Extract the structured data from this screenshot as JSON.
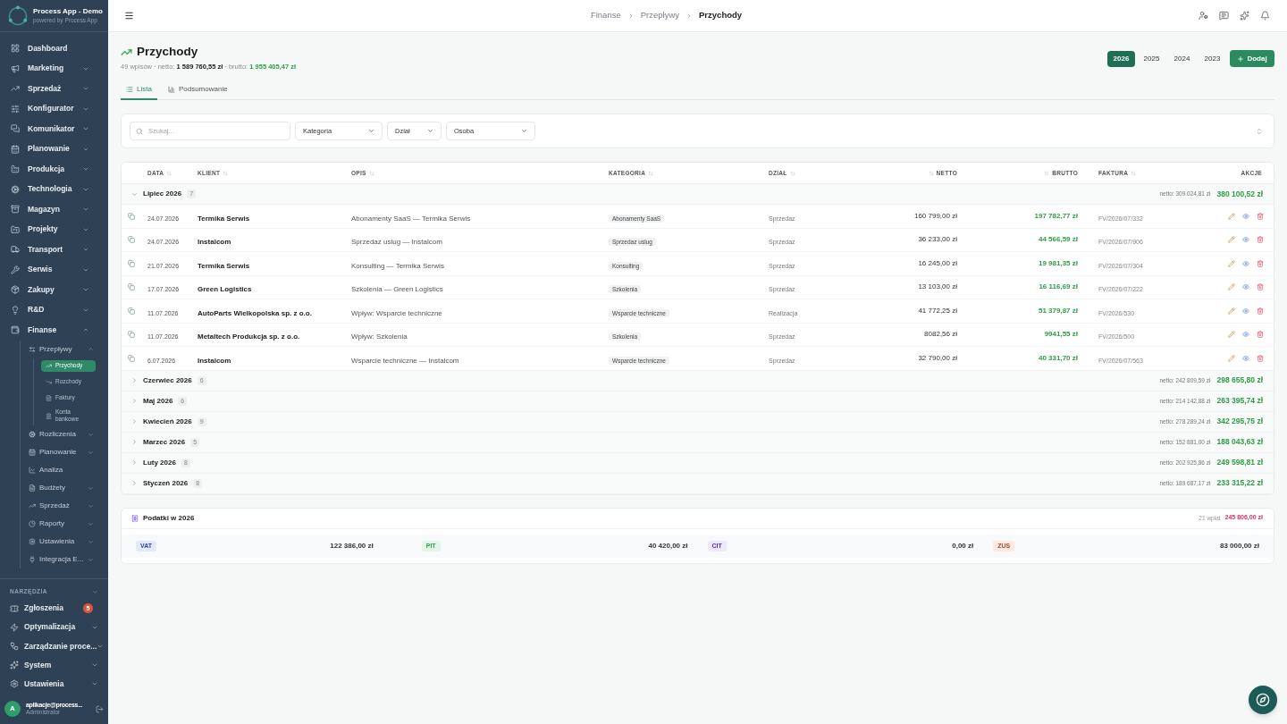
{
  "sidebar": {
    "brand": {
      "title": "Process App - Demo",
      "subtitle": "powered by Process App"
    },
    "items": [
      {
        "label": "Dashboard",
        "kind": "link",
        "selected": false
      },
      {
        "label": "Marketing",
        "kind": "group",
        "expanded": false
      },
      {
        "label": "Sprzedaż",
        "kind": "group",
        "expanded": false
      },
      {
        "label": "Konfigurator",
        "kind": "group",
        "expanded": false
      },
      {
        "label": "Komunikator",
        "kind": "group",
        "expanded": false
      },
      {
        "label": "Planowanie",
        "kind": "group",
        "expanded": false
      },
      {
        "label": "Produkcja",
        "kind": "group",
        "expanded": false
      },
      {
        "label": "Technologia",
        "kind": "group",
        "expanded": false
      },
      {
        "label": "Magazyn",
        "kind": "group",
        "expanded": false
      },
      {
        "label": "Projekty",
        "kind": "group",
        "expanded": false
      },
      {
        "label": "Transport",
        "kind": "group",
        "expanded": false
      },
      {
        "label": "Serwis",
        "kind": "group",
        "expanded": false
      },
      {
        "label": "Zakupy",
        "kind": "group",
        "expanded": false
      },
      {
        "label": "R&D",
        "kind": "group",
        "expanded": false
      },
      {
        "label": "Finanse",
        "kind": "group",
        "expanded": true,
        "children": [
          {
            "label": "Przepływy",
            "kind": "group",
            "expanded": true,
            "children": [
              {
                "label": "Przychody",
                "kind": "link",
                "selected": true
              },
              {
                "label": "Rozchody",
                "kind": "link",
                "selected": false
              },
              {
                "label": "Faktury",
                "kind": "link",
                "selected": false
              },
              {
                "label": "Konta bankowe",
                "kind": "link",
                "selected": false
              }
            ]
          },
          {
            "label": "Rozliczenia",
            "kind": "group",
            "expanded": false
          },
          {
            "label": "Planowanie",
            "kind": "group",
            "expanded": false
          },
          {
            "label": "Analiza",
            "kind": "link",
            "selected": false
          },
          {
            "label": "Budżety",
            "kind": "group",
            "expanded": false
          },
          {
            "label": "Sprzedaż",
            "kind": "group",
            "expanded": false
          },
          {
            "label": "Raporty",
            "kind": "group",
            "expanded": false
          },
          {
            "label": "Ustawienia",
            "kind": "group",
            "expanded": false
          },
          {
            "label": "Integracja E...",
            "kind": "group",
            "expanded": false
          }
        ]
      }
    ],
    "tools": {
      "title": "NARZĘDZIA",
      "items": [
        {
          "label": "Zgłoszenia",
          "kind": "link",
          "selected": false,
          "badge": "5"
        },
        {
          "label": "Optymalizacja",
          "kind": "group",
          "expanded": false
        },
        {
          "label": "Zarządzanie proce...",
          "kind": "group",
          "expanded": false
        },
        {
          "label": "System",
          "kind": "group",
          "expanded": false
        },
        {
          "label": "Ustawienia",
          "kind": "group",
          "expanded": false
        }
      ]
    },
    "user": {
      "initial": "A",
      "name": "aplikacje@process...",
      "role": "Administrator"
    }
  },
  "header": {
    "breadcrumb": [
      "Finanse",
      "Przepływy",
      "Przychody"
    ]
  },
  "page": {
    "title": "Przychody",
    "summary": [
      {
        "text": "49 wpisów · netto:",
        "kind": "muted"
      },
      {
        "text": "1 589 760,55 zł",
        "kind": "strong"
      },
      {
        "text": "· brutto:",
        "kind": "muted"
      },
      {
        "text": "1 955 405,47 zł",
        "kind": "accent"
      }
    ],
    "years": [
      {
        "label": "2026",
        "selected": true
      },
      {
        "label": "2025",
        "selected": false
      },
      {
        "label": "2024",
        "selected": false
      },
      {
        "label": "2023",
        "selected": false
      }
    ],
    "add_button": "Dodaj"
  },
  "tabs": [
    {
      "label": "Lista",
      "selected": true
    },
    {
      "label": "Podsumowanie",
      "selected": false
    }
  ],
  "filters": {
    "search": {
      "placeholder": "Szukaj..."
    },
    "selects": [
      "Kategoria",
      "Dział",
      "Osoba"
    ]
  },
  "table": {
    "columns": [
      "DATA",
      "KLIENT",
      "OPIS",
      "KATEGORIA",
      "DZIAŁ",
      "NETTO",
      "BRUTTO",
      "FAKTURA",
      "AKCJE"
    ],
    "groups": [
      {
        "label": "Lipiec 2026",
        "count": "7",
        "expanded": true,
        "netto": "netto: 309 024,81 zł",
        "brutto": "380 100,52 zł",
        "rows": [
          {
            "date": "24.07.2026",
            "client": "Termika Serwis",
            "description": "Abonamenty SaaS — Termika Serwis",
            "category": "Abonamenty SaaS",
            "department": "Sprzedaz",
            "netto": "160 799,00 zł",
            "brutto": "197 782,77 zł",
            "invoice": "FV/2026/07/332"
          },
          {
            "date": "24.07.2026",
            "client": "Instalcom",
            "description": "Sprzedaz uslug — Instalcom",
            "category": "Sprzedaz uslug",
            "department": "Sprzedaz",
            "netto": "36 233,00 zł",
            "brutto": "44 566,59 zł",
            "invoice": "FV/2026/07/906"
          },
          {
            "date": "21.07.2026",
            "client": "Termika Serwis",
            "description": "Konsulting — Termika Serwis",
            "category": "Konsulting",
            "department": "Sprzedaz",
            "netto": "16 245,00 zł",
            "brutto": "19 981,35 zł",
            "invoice": "FV/2026/07/304"
          },
          {
            "date": "17.07.2026",
            "client": "Green Logistics",
            "description": "Szkolenia — Green Logistics",
            "category": "Szkolenia",
            "department": "Sprzedaz",
            "netto": "13 103,00 zł",
            "brutto": "16 116,69 zł",
            "invoice": "FV/2026/07/222"
          },
          {
            "date": "11.07.2026",
            "client": "AutoParts Wielkopolska sp. z o.o.",
            "description": "Wpływ: Wsparcie techniczne",
            "category": "Wsparcie techniczne",
            "department": "Realizacja",
            "netto": "41 772,25 zł",
            "brutto": "51 379,87 zł",
            "invoice": "FV/2026/530"
          },
          {
            "date": "11.07.2026",
            "client": "Metaltech Produkcja sp. z o.o.",
            "description": "Wpływ: Szkolenia",
            "category": "Szkolenia",
            "department": "Sprzedaz",
            "netto": "8082,56 zł",
            "brutto": "9941,55 zł",
            "invoice": "FV/2026/500"
          },
          {
            "date": "6.07.2026",
            "client": "Instalcom",
            "description": "Wsparcie techniczne — Instalcom",
            "category": "Wsparcie techniczne",
            "department": "Sprzedaz",
            "netto": "32 790,00 zł",
            "brutto": "40 331,70 zł",
            "invoice": "FV/2026/07/563"
          }
        ]
      },
      {
        "label": "Czerwiec 2026",
        "count": "6",
        "expanded": false,
        "netto": "netto: 242 809,59 zł",
        "brutto": "298 655,80 zł"
      },
      {
        "label": "Maj 2026",
        "count": "6",
        "expanded": false,
        "netto": "netto: 214 142,88 zł",
        "brutto": "263 395,74 zł"
      },
      {
        "label": "Kwiecień 2026",
        "count": "9",
        "expanded": false,
        "netto": "netto: 278 289,24 zł",
        "brutto": "342 295,75 zł"
      },
      {
        "label": "Marzec 2026",
        "count": "5",
        "expanded": false,
        "netto": "netto: 152 881,00 zł",
        "brutto": "188 043,63 zł"
      },
      {
        "label": "Luty 2026",
        "count": "8",
        "expanded": false,
        "netto": "netto: 202 925,86 zł",
        "brutto": "249 598,81 zł"
      },
      {
        "label": "Styczeń 2026",
        "count": "8",
        "expanded": false,
        "netto": "netto: 189 687,17 zł",
        "brutto": "233 315,22 zł"
      }
    ]
  },
  "taxes": {
    "title": "Podatki w 2026",
    "count": "21 wpłat",
    "total": "245 806,00 zł",
    "items": [
      {
        "label": "VAT",
        "amount": "122 386,00 zł",
        "color": "#e4e8fb"
      },
      {
        "label": "PIT",
        "amount": "40 420,00 zł",
        "color": "#e2f6e7"
      },
      {
        "label": "CIT",
        "amount": "0,00 zł",
        "color": "#ede7fb"
      },
      {
        "label": "ZUS",
        "amount": "83 000,00 zł",
        "color": "#fde9df"
      }
    ]
  }
}
